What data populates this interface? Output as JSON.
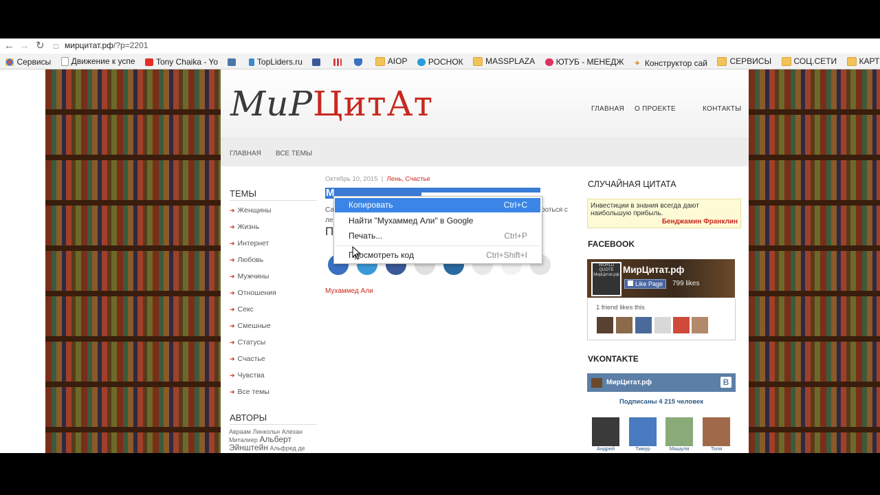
{
  "browser": {
    "url_host": "мирцитат.рф",
    "url_path": "/?p=2201",
    "bookmarks": [
      {
        "label": "Сервисы",
        "icon": "apps-grid-icon",
        "color": "#e84a3a"
      },
      {
        "label": "Движение к успе",
        "icon": "page-icon",
        "color": "#bbbbbb"
      },
      {
        "label": "Tony Chaika - Yo",
        "icon": "youtube-icon",
        "color": "#e52d27"
      },
      {
        "label": "",
        "icon": "vk-icon",
        "color": "#4a76a8"
      },
      {
        "label": "TopLiders.ru",
        "icon": "wing-icon",
        "color": "#3a8ad0"
      },
      {
        "label": "",
        "icon": "facebook-icon",
        "color": "#3b5998"
      },
      {
        "label": "",
        "icon": "chart-icon",
        "color": "#d04040"
      },
      {
        "label": "",
        "icon": "shield-icon",
        "color": "#3a70c0"
      },
      {
        "label": "AIOP",
        "icon": "folder-icon",
        "color": "#f3c35a"
      },
      {
        "label": "РОСНОК",
        "icon": "folder-icon",
        "color": "#f3c35a"
      },
      {
        "label": "MASSPLAZA",
        "icon": "folder-icon",
        "color": "#f3c35a"
      },
      {
        "label": "ЮТУБ - МЕНЕДЖ",
        "icon": "heart-icon",
        "color": "#e03060"
      },
      {
        "label": "Конструктор сай",
        "icon": "star-icon",
        "color": "#e09030"
      },
      {
        "label": "СЕРВИСЫ",
        "icon": "folder-icon",
        "color": "#f3c35a"
      },
      {
        "label": "СОЦ.СЕТИ",
        "icon": "folder-icon",
        "color": "#f3c35a"
      },
      {
        "label": "КАРТИНКИ",
        "icon": "folder-icon",
        "color": "#f3c35a"
      }
    ]
  },
  "site": {
    "logo_part1": "МиР",
    "logo_part2": "ЦитАт",
    "top_nav": [
      "ГЛАВНАЯ",
      "О ПРОЕКТЕ",
      "КОНТАКТЫ"
    ],
    "sub_nav": [
      "ГЛАВНАЯ",
      "ВСЕ ТЕМЫ"
    ],
    "themes_heading": "ТЕМЫ",
    "themes": [
      "Женщины",
      "Жизнь",
      "Интернет",
      "Любовь",
      "Мужчины",
      "Отношения",
      "Секс",
      "Смешные",
      "Статусы",
      "Счастье",
      "Чувства",
      "Все темы"
    ],
    "authors_heading": "АВТОРЫ",
    "authors_line1": "Авраам Линкольн Алехан",
    "authors_line2_small": "Миталиер",
    "authors_line2_big": "Альберт",
    "authors_line3_big": "Эйнштейн",
    "authors_line3_small": "Альфред де"
  },
  "post": {
    "date": "Октябрь 10, 2015",
    "sep": "|",
    "categories": "Лень, Счастье",
    "title_initial": "М",
    "frag_left1": "Са",
    "frag_left2": "ле",
    "frag_right": "роться с",
    "frag_heading": "П",
    "author_link": "Мухаммед Али"
  },
  "right": {
    "random_quote_heading": "СЛУЧАЙНАЯ ЦИТАТА",
    "quote_text": "Инвестиции в знания всегда дают наибольшую прибыль.",
    "quote_author": "Бенджамин Франклин",
    "facebook_heading": "FACEBOOK",
    "fb_page_name": "МирЦитат.рф",
    "fb_like_label": "Like Page",
    "fb_like_count": "799 likes",
    "fb_friends": "1 friend likes this",
    "fb_thumb_text": "WORLD QUOTE МирЦитат.рф",
    "vk_heading": "VKONTAKTE",
    "vk_name": "МирЦитат.рф",
    "vk_logo": "В",
    "vk_subscribers": "Подписаны 4 215 человек",
    "vk_members": [
      "Андрей",
      "Тимур",
      "Машуля",
      "Толя"
    ]
  },
  "context_menu": {
    "items": [
      {
        "label": "Копировать",
        "shortcut": "Ctrl+C"
      },
      {
        "label": "Найти \"Мухаммед Али\" в Google",
        "shortcut": ""
      },
      {
        "label": "Печать...",
        "shortcut": "Ctrl+P"
      },
      {
        "label": "Просмотреть код",
        "shortcut": "Ctrl+Shift+I"
      }
    ]
  }
}
